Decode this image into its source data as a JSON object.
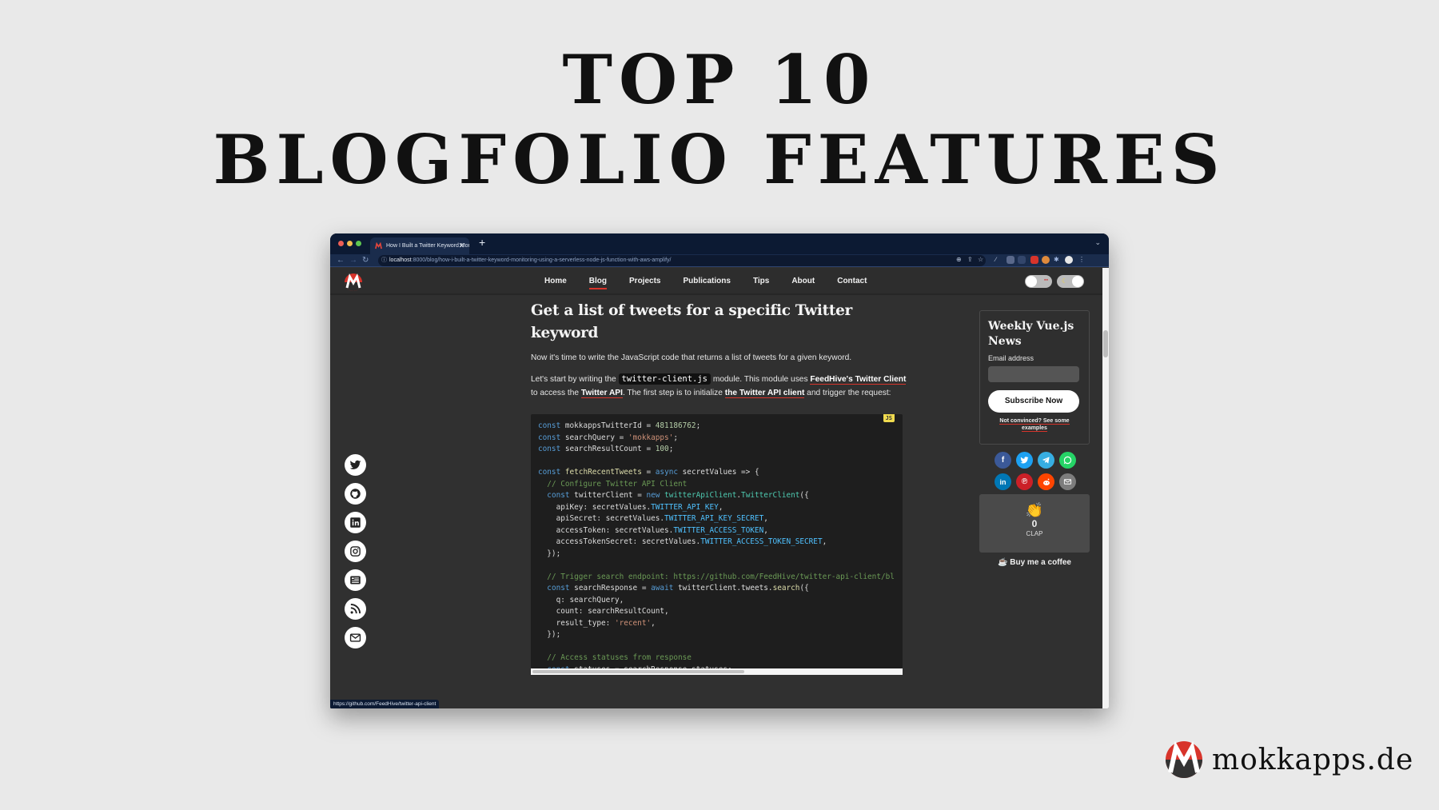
{
  "headline": {
    "line1": "TOP 10",
    "line2": "BLOGFOLIO FEATURES"
  },
  "browser": {
    "tab_title": "How I Built a Twitter Keyword Monitoring",
    "url_host": "localhost",
    "url_path": ":8000/blog/how-i-built-a-twitter-keyword-monitoring-using-a-serverless-node-js-function-with-aws-amplify/",
    "status_url": "https://github.com/FeedHive/twitter-api-client"
  },
  "site": {
    "nav": [
      {
        "label": "Home",
        "active": false
      },
      {
        "label": "Blog",
        "active": true
      },
      {
        "label": "Projects",
        "active": false
      },
      {
        "label": "Publications",
        "active": false
      },
      {
        "label": "Tips",
        "active": false
      },
      {
        "label": "About",
        "active": false
      },
      {
        "label": "Contact",
        "active": false
      }
    ],
    "socials": [
      "twitter-icon",
      "github-icon",
      "linkedin-icon",
      "instagram-icon",
      "newsletter-icon",
      "rss-icon",
      "mail-icon"
    ]
  },
  "article": {
    "heading": "Get a list of tweets for a specific Twitter keyword",
    "p1": "Now it's time to write the JavaScript code that returns a list of tweets for a given keyword.",
    "p2_a": "Let's start by writing the ",
    "p2_code": "twitter-client.js",
    "p2_b": " module. This module uses ",
    "p2_link1": "FeedHive's Twitter Client",
    "p2_c": " to access the ",
    "p2_link2": "Twitter API",
    "p2_d": ". The first step is to initialize ",
    "p2_link3": "the Twitter API client",
    "p2_e": " and trigger the request:",
    "code_lang": "JS",
    "code_lines": [
      "const mokkappsTwitterId = 481186762;",
      "const searchQuery = 'mokkapps';",
      "const searchResultCount = 100;",
      "",
      "const fetchRecentTweets = async secretValues => {",
      "  // Configure Twitter API Client",
      "  const twitterClient = new twitterApiClient.TwitterClient({",
      "    apiKey: secretValues.TWITTER_API_KEY,",
      "    apiSecret: secretValues.TWITTER_API_KEY_SECRET,",
      "    accessToken: secretValues.TWITTER_ACCESS_TOKEN,",
      "    accessTokenSecret: secretValues.TWITTER_ACCESS_TOKEN_SECRET,",
      "  });",
      "",
      "  // Trigger search endpoint: https://github.com/FeedHive/twitter-api-client/bl",
      "  const searchResponse = await twitterClient.tweets.search({",
      "    q: searchQuery,",
      "    count: searchResultCount,",
      "    result_type: 'recent',",
      "  });",
      "",
      "  // Access statuses from response",
      "  const statuses = searchResponse.statuses;",
      "};"
    ]
  },
  "sidebar": {
    "newsletter_title": "Weekly Vue.js News",
    "email_label": "Email address",
    "email_placeholder": "",
    "subscribe_label": "Subscribe Now",
    "not_convinced": "Not convinced? See some examples",
    "share_row1": [
      "facebook-icon",
      "twitter-icon",
      "telegram-icon",
      "whatsapp-icon"
    ],
    "share_row2": [
      "linkedin-icon",
      "pinterest-icon",
      "reddit-icon",
      "email-icon"
    ],
    "clap_count": "0",
    "clap_label": "CLAP",
    "coffee_label": "Buy me a coffee"
  },
  "brand": {
    "name": "mokkapps.de"
  },
  "colors": {
    "accent": "#d8342b",
    "chrome": "#0c1a33",
    "site_bg": "#303030"
  }
}
